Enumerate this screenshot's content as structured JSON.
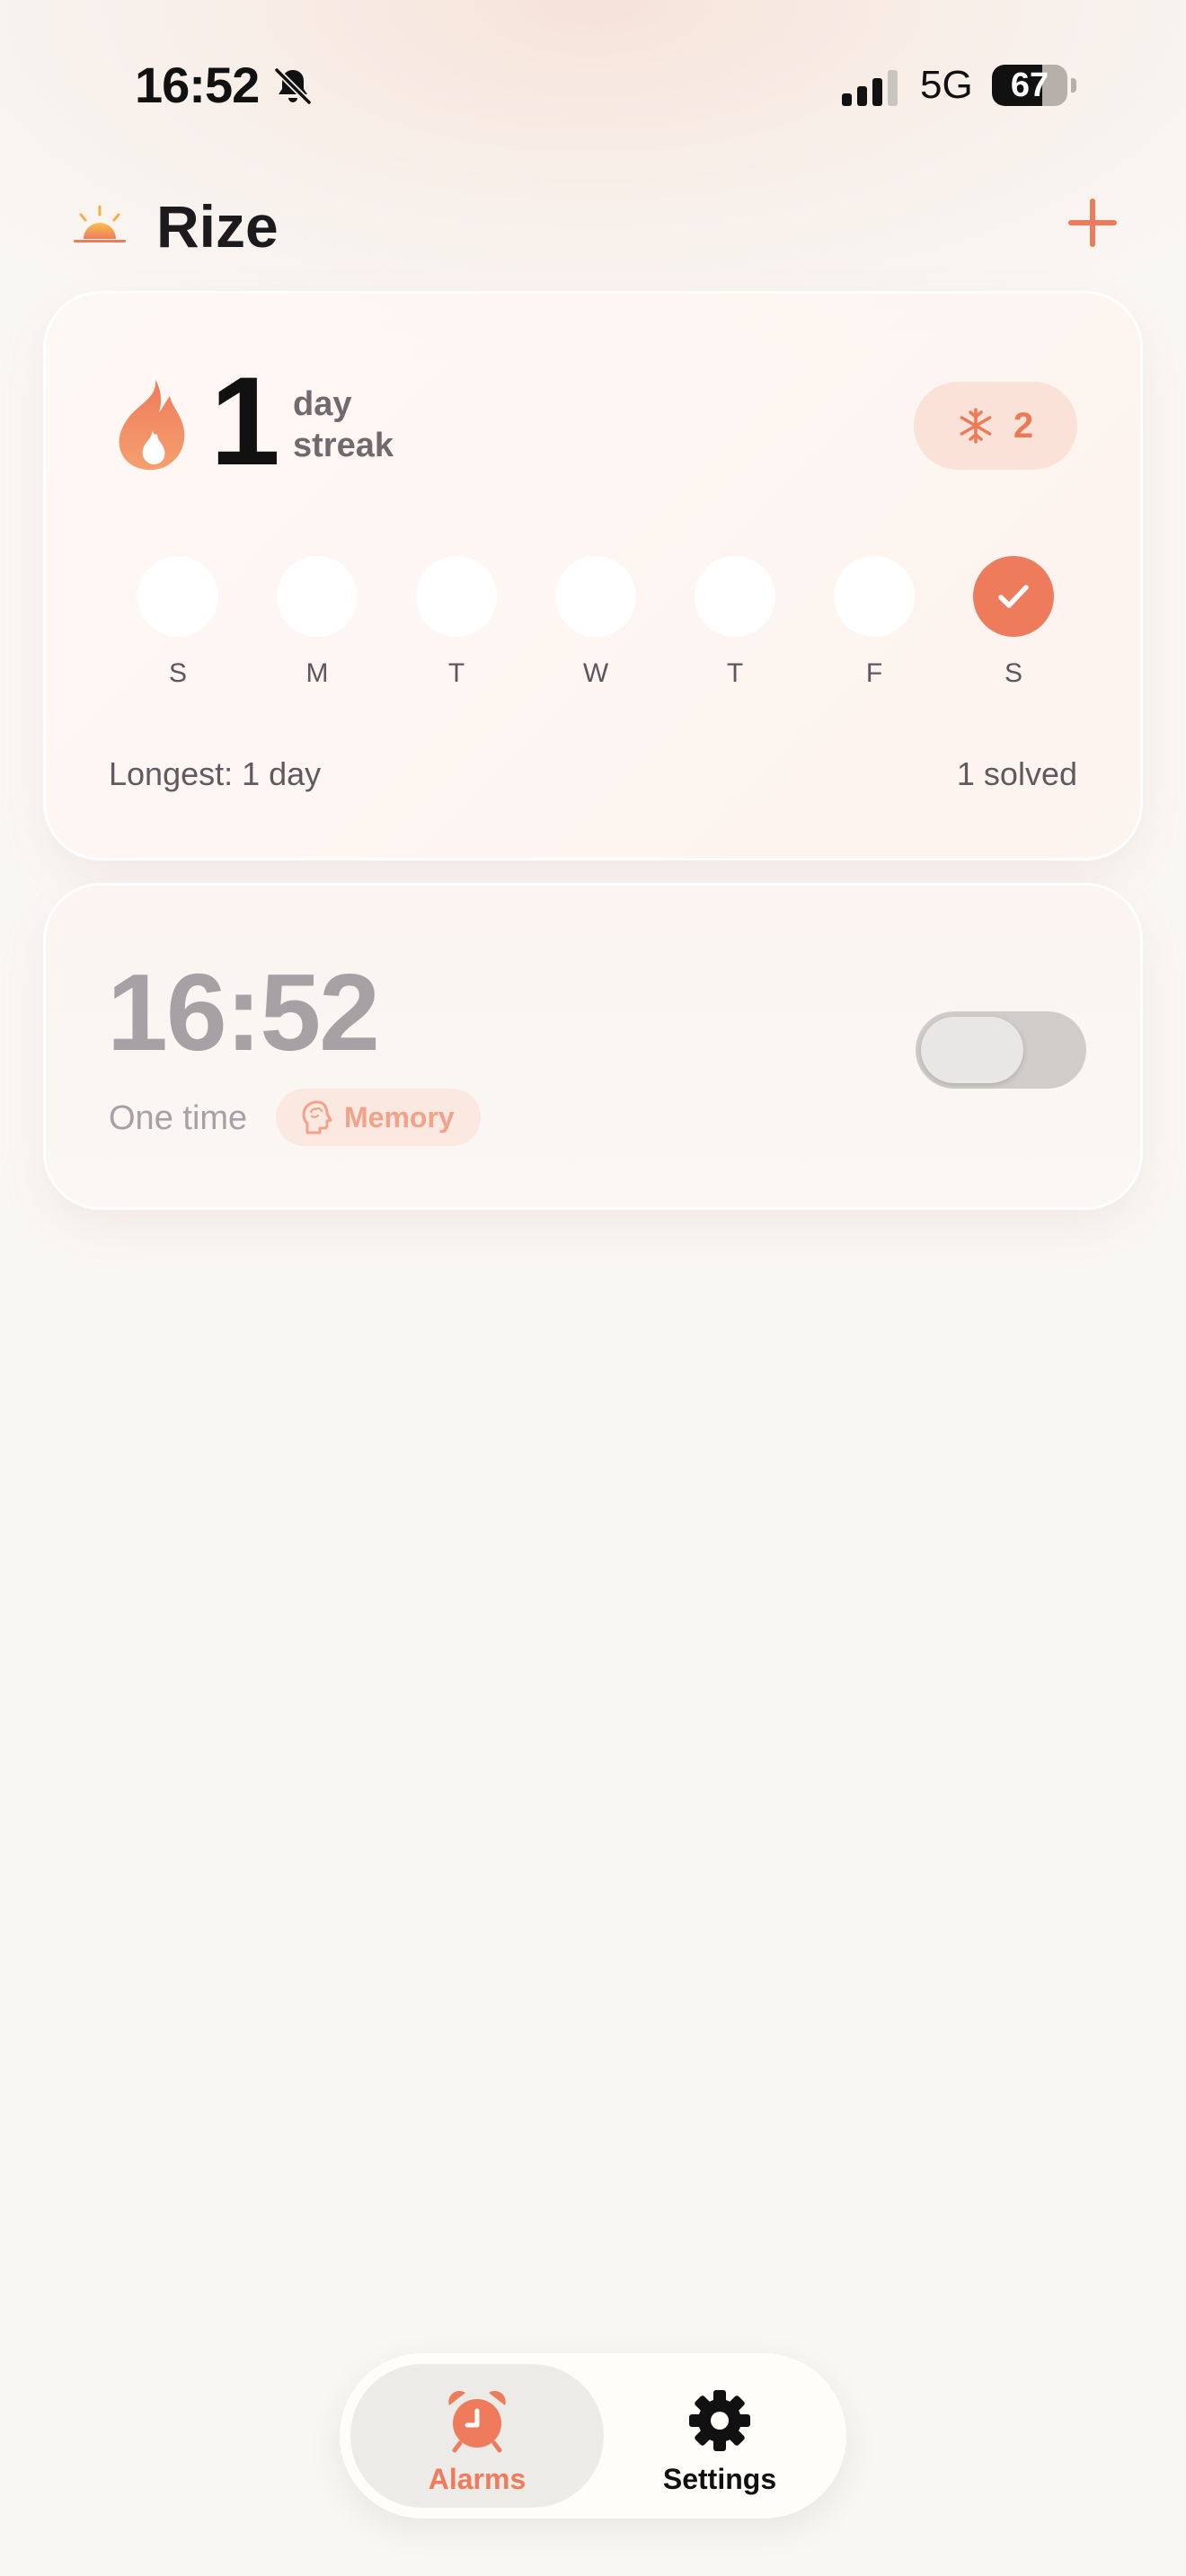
{
  "status_bar": {
    "time": "16:52",
    "network": "5G",
    "battery": "67",
    "battery_level": 0.67
  },
  "header": {
    "title": "Rize",
    "add_icon": "plus-icon",
    "logo_icon": "sunrise-icon"
  },
  "streak": {
    "count": "1",
    "unit_line1": "day",
    "unit_line2": "streak",
    "freeze_count": "2",
    "days": [
      {
        "label": "S",
        "done": false
      },
      {
        "label": "M",
        "done": false
      },
      {
        "label": "T",
        "done": false
      },
      {
        "label": "W",
        "done": false
      },
      {
        "label": "T",
        "done": false
      },
      {
        "label": "F",
        "done": false
      },
      {
        "label": "S",
        "done": true
      }
    ],
    "longest": "Longest: 1 day",
    "solved": "1 solved"
  },
  "alarm": {
    "time": "16:52",
    "repeat": "One time",
    "challenge": "Memory",
    "enabled": false
  },
  "tabs": {
    "alarms": "Alarms",
    "settings": "Settings"
  },
  "colors": {
    "accent": "#ee7b5c",
    "text": "#111111",
    "muted": "#a7a1a5"
  }
}
